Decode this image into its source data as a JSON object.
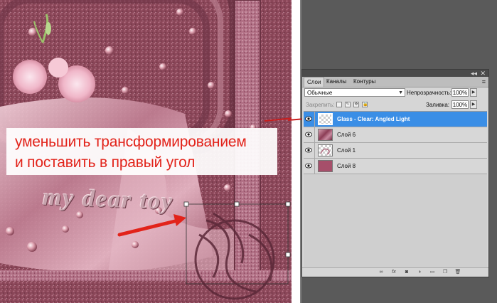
{
  "annotation": {
    "line1": "уменьшить трансформированием",
    "line2": " и поставить в правый угол"
  },
  "watermark": "my dear toy",
  "panel": {
    "tabs": [
      {
        "label": "Слои",
        "active": true
      },
      {
        "label": "Каналы",
        "active": false
      },
      {
        "label": "Контуры",
        "active": false
      }
    ],
    "blend_mode": "Обычные",
    "opacity_label": "Непрозрачность:",
    "opacity_value": "100%",
    "lock_label": "Закрепить:",
    "fill_label": "Заливка:",
    "fill_value": "100%",
    "layers": [
      {
        "name": "Glass - Clear: Angled Light",
        "thumb": "checker",
        "selected": true
      },
      {
        "name": "Слой 6",
        "thumb": "photo",
        "selected": false
      },
      {
        "name": "Слой 1",
        "thumb": "checker",
        "selected": false
      },
      {
        "name": "Слой 8",
        "thumb": "pink",
        "selected": false
      }
    ],
    "footer_icons": [
      "link-icon",
      "fx-icon",
      "mask-icon",
      "adjustment-icon",
      "folder-icon",
      "new-layer-icon",
      "trash-icon"
    ]
  },
  "colors": {
    "annotation_red": "#e2231a",
    "selected_layer": "#3a8ee6",
    "panel_bg": "#d6d6d6"
  }
}
